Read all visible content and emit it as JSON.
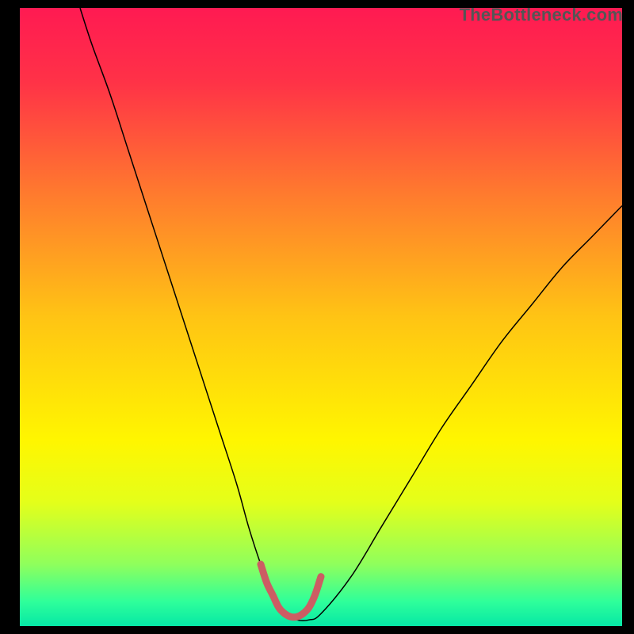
{
  "watermark": "TheBottleneck.com",
  "chart_data": {
    "type": "line",
    "title": "",
    "xlabel": "",
    "ylabel": "",
    "xlim": [
      0,
      100
    ],
    "ylim": [
      0,
      100
    ],
    "grid": false,
    "legend": false,
    "background_gradient": {
      "direction": "vertical",
      "stops": [
        {
          "offset": 0.0,
          "color": "#ff1a52"
        },
        {
          "offset": 0.12,
          "color": "#ff3247"
        },
        {
          "offset": 0.3,
          "color": "#ff7a2e"
        },
        {
          "offset": 0.5,
          "color": "#ffc414"
        },
        {
          "offset": 0.7,
          "color": "#fff600"
        },
        {
          "offset": 0.8,
          "color": "#e4ff1a"
        },
        {
          "offset": 0.9,
          "color": "#8fff5c"
        },
        {
          "offset": 0.96,
          "color": "#2fff9a"
        },
        {
          "offset": 1.0,
          "color": "#06e8a6"
        }
      ]
    },
    "series": [
      {
        "name": "bottleneck-curve",
        "color": "#000000",
        "width": 1.5,
        "x": [
          10,
          12,
          15,
          18,
          21,
          24,
          27,
          30,
          33,
          36,
          38,
          40,
          42,
          44,
          46,
          48,
          50,
          55,
          60,
          65,
          70,
          75,
          80,
          85,
          90,
          95,
          100
        ],
        "y": [
          100,
          94,
          86,
          77,
          68,
          59,
          50,
          41,
          32,
          23,
          16,
          10,
          5,
          2,
          1,
          1,
          2,
          8,
          16,
          24,
          32,
          39,
          46,
          52,
          58,
          63,
          68
        ]
      },
      {
        "name": "bottleneck-highlight",
        "color": "#cc5d63",
        "width": 9,
        "linecap": "round",
        "x": [
          40.0,
          41.0,
          42.0,
          43.0,
          44.0,
          45.0,
          46.0,
          47.0,
          48.0,
          49.0,
          50.0
        ],
        "y": [
          10.0,
          7.0,
          5.0,
          3.0,
          2.0,
          1.5,
          1.5,
          2.0,
          3.0,
          5.0,
          8.0
        ]
      }
    ]
  }
}
